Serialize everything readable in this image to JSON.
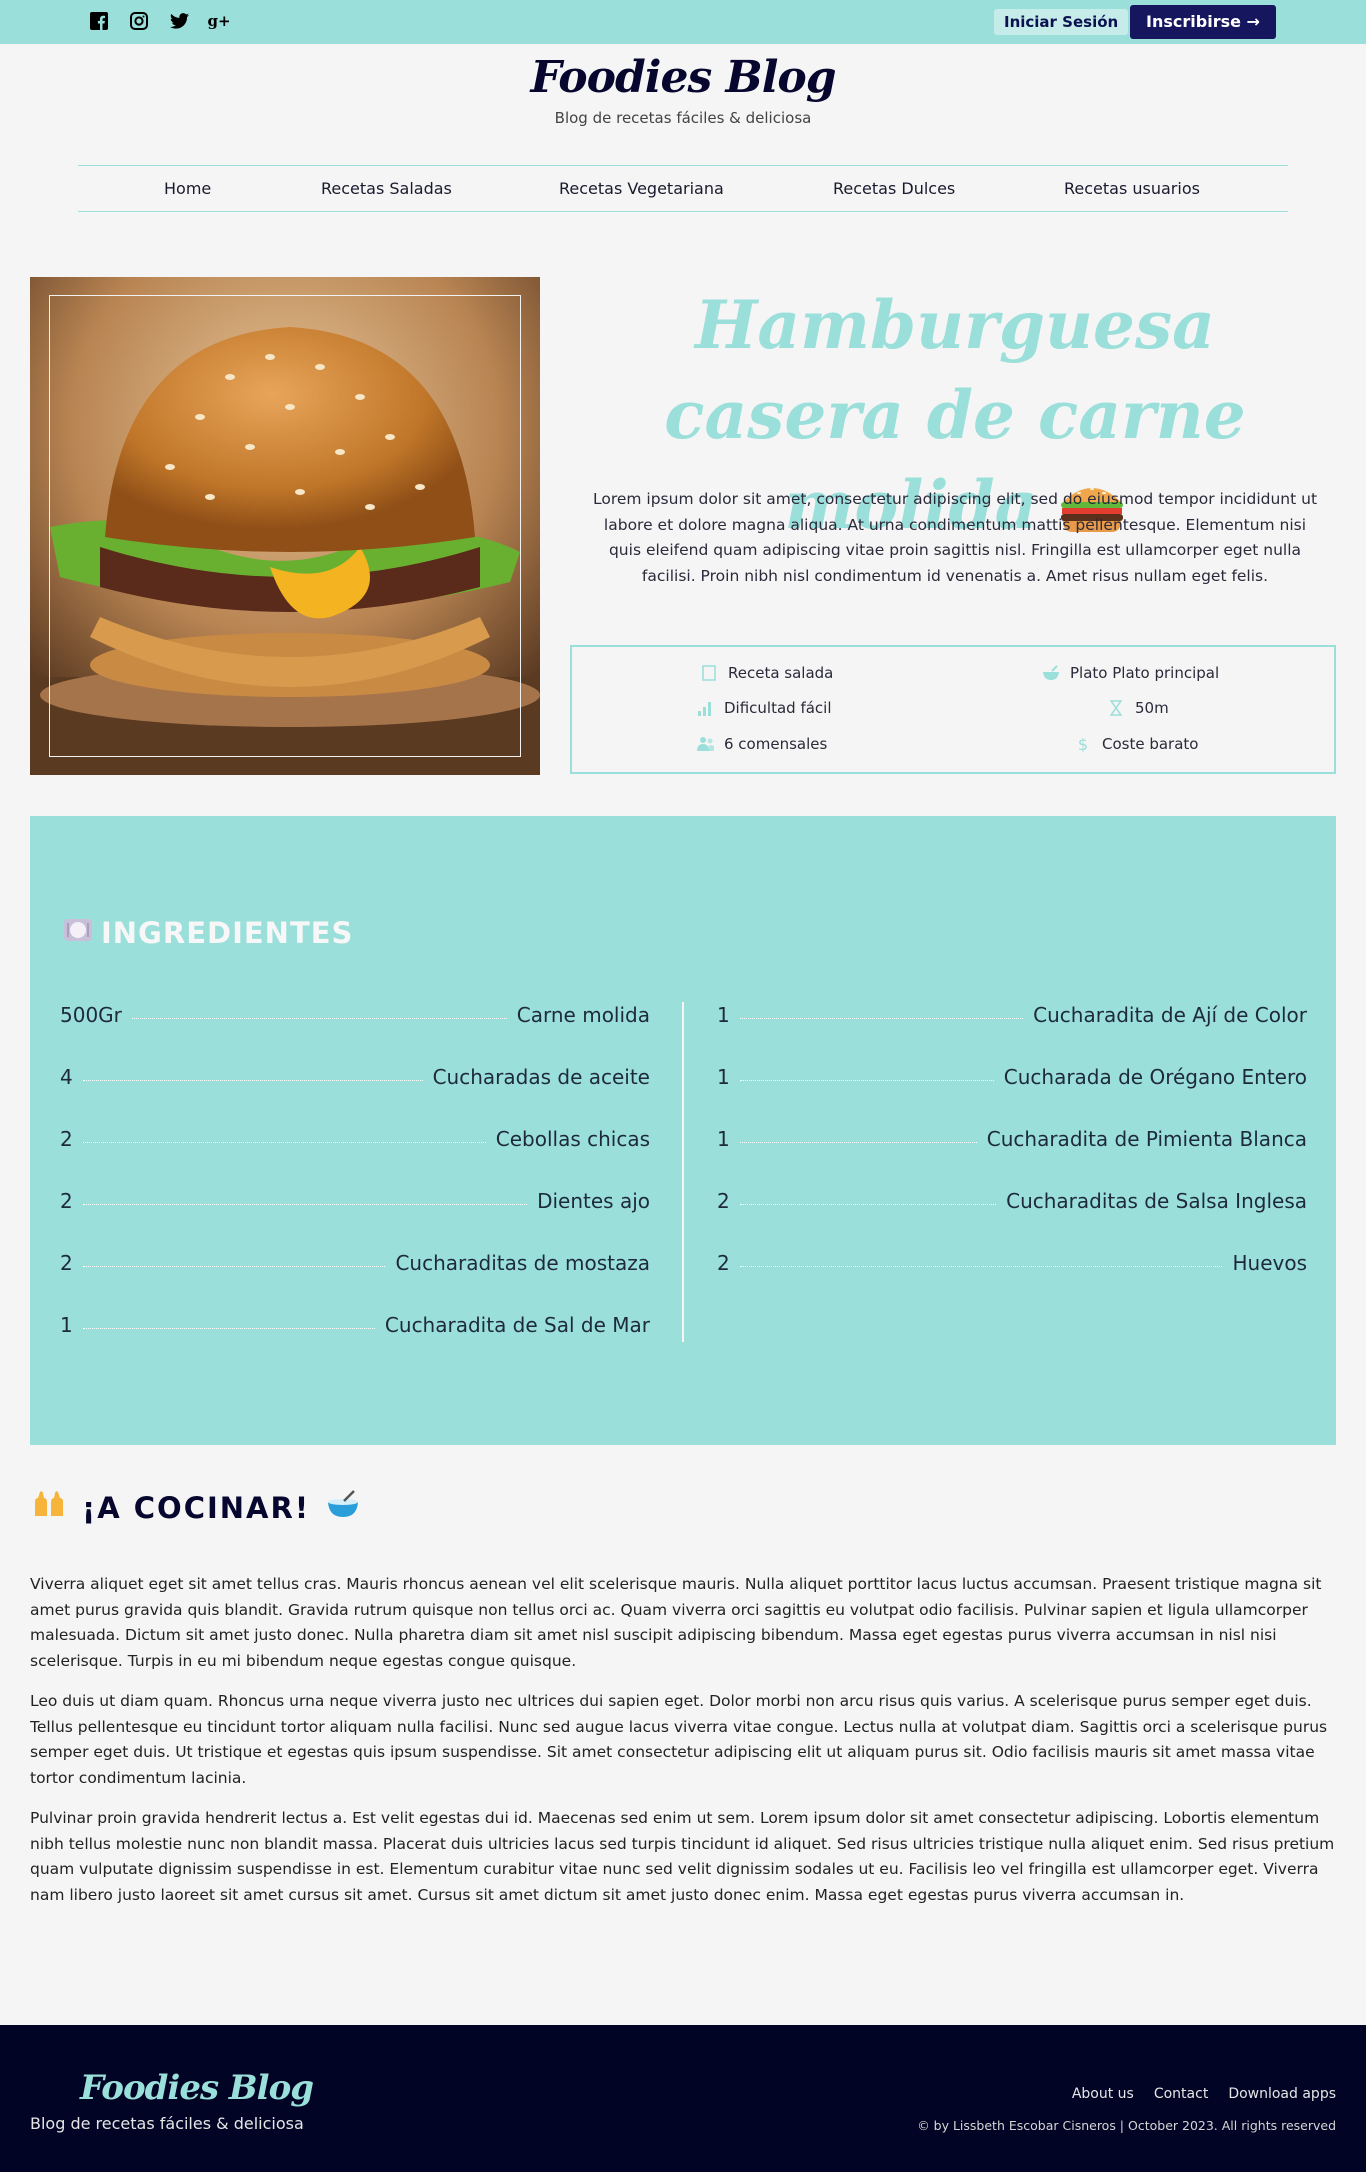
{
  "topbar": {
    "social": [
      "facebook-icon",
      "instagram-icon",
      "twitter-icon",
      "google-plus-icon"
    ],
    "login_label": "Iniciar Sesión",
    "signup_label": "Inscribirse →"
  },
  "brand": {
    "title": "Foodies Blog",
    "subtitle": "Blog de recetas fáciles & deliciosa"
  },
  "nav": {
    "items": [
      "Home",
      "Recetas Saladas",
      "Recetas Vegetariana",
      "Recetas Dulces",
      "Recetas usuarios"
    ]
  },
  "recipe": {
    "title": "Hamburguesa casera de carne molida",
    "description": "Lorem ipsum dolor sit amet, consectetur adipiscing elit, sed do eiusmod tempor incididunt ut labore et dolore magna aliqua. At urna condimentum mattis pellentesque. Elementum nisi quis eleifend quam adipiscing vitae proin sagittis nisl. Fringilla est ullamcorper eget nulla facilisi. Proin nibh nisl condimentum id venenatis a. Amet risus nullam eget felis.",
    "info": {
      "type": "Receta salada",
      "course": "Plato Plato principal",
      "difficulty": "Dificultad fácil",
      "time": "50m",
      "servings": "6 comensales",
      "cost": "Coste barato"
    }
  },
  "ingredients": {
    "title": "INGREDIENTES",
    "left": [
      {
        "qty": "500Gr",
        "name": "Carne molida"
      },
      {
        "qty": "4",
        "name": "Cucharadas de aceite"
      },
      {
        "qty": "2",
        "name": "Cebollas chicas"
      },
      {
        "qty": "2",
        "name": "Dientes ajo"
      },
      {
        "qty": "2",
        "name": "Cucharaditas de mostaza"
      },
      {
        "qty": "1",
        "name": "Cucharadita de Sal de Mar"
      }
    ],
    "right": [
      {
        "qty": "1",
        "name": "Cucharadita de Ají de Color"
      },
      {
        "qty": "1",
        "name": "Cucharada de Orégano Entero"
      },
      {
        "qty": "1",
        "name": "Cucharadita de Pimienta Blanca"
      },
      {
        "qty": "2",
        "name": "Cucharaditas de Salsa Inglesa"
      },
      {
        "qty": "2",
        "name": "Huevos"
      }
    ]
  },
  "cook": {
    "title": "¡A COCINAR!",
    "paragraphs": [
      "Viverra aliquet eget sit amet tellus cras. Mauris rhoncus aenean vel elit scelerisque mauris. Nulla aliquet porttitor lacus luctus accumsan. Praesent tristique magna sit amet purus gravida quis blandit. Gravida rutrum quisque non tellus orci ac. Quam viverra orci sagittis eu volutpat odio facilisis. Pulvinar sapien et ligula ullamcorper malesuada. Dictum sit amet justo donec. Nulla pharetra diam sit amet nisl suscipit adipiscing bibendum. Massa eget egestas purus viverra accumsan in nisl nisi scelerisque. Turpis in eu mi bibendum neque egestas congue quisque.",
      "Leo duis ut diam quam. Rhoncus urna neque viverra justo nec ultrices dui sapien eget. Dolor morbi non arcu risus quis varius. A scelerisque purus semper eget duis. Tellus pellentesque eu tincidunt tortor aliquam nulla facilisi. Nunc sed augue lacus viverra vitae congue. Lectus nulla at volutpat diam. Sagittis orci a scelerisque purus semper eget duis. Ut tristique et egestas quis ipsum suspendisse. Sit amet consectetur adipiscing elit ut aliquam purus sit. Odio facilisis mauris sit amet massa vitae tortor condimentum lacinia.",
      "Pulvinar proin gravida hendrerit lectus a. Est velit egestas dui id. Maecenas sed enim ut sem. Lorem ipsum dolor sit amet consectetur adipiscing. Lobortis elementum nibh tellus molestie nunc non blandit massa. Placerat duis ultricies lacus sed turpis tincidunt id aliquet. Sed risus ultricies tristique nulla aliquet enim. Sed risus pretium quam vulputate dignissim suspendisse in est. Elementum curabitur vitae nunc sed velit dignissim sodales ut eu. Facilisis leo vel fringilla est ullamcorper eget. Viverra nam libero justo laoreet sit amet cursus sit amet. Cursus sit amet dictum sit amet justo donec enim. Massa eget egestas purus viverra accumsan in."
    ]
  },
  "footer": {
    "brand": "Foodies Blog",
    "subtitle": "Blog de recetas fáciles & deliciosa",
    "links": [
      "About us",
      "Contact",
      "Download apps"
    ],
    "copyright": "© by Lissbeth Escobar Cisneros | October 2023. All rights reserved"
  },
  "colors": {
    "accent": "#9adfda",
    "navy": "#16165e",
    "footer_bg": "#020425"
  }
}
